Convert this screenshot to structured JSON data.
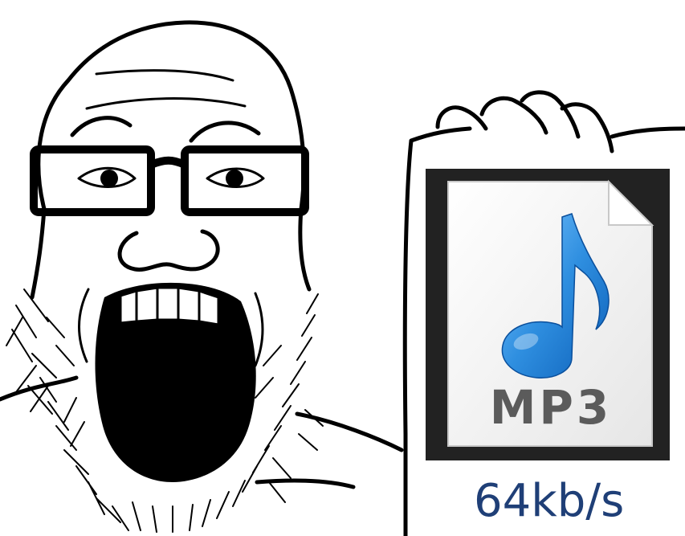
{
  "meme": {
    "character": "soyjak",
    "held_item": {
      "icon": "mp3-file-icon",
      "file_type_label": "MP3",
      "caption": "64kb/s"
    }
  },
  "colors": {
    "background": "#ffffff",
    "ink": "#000000",
    "icon_frame": "#222222",
    "note_blue": "#2f8fe0",
    "caption_blue": "#1f3f77",
    "label_gray": "#5b5b5b"
  }
}
